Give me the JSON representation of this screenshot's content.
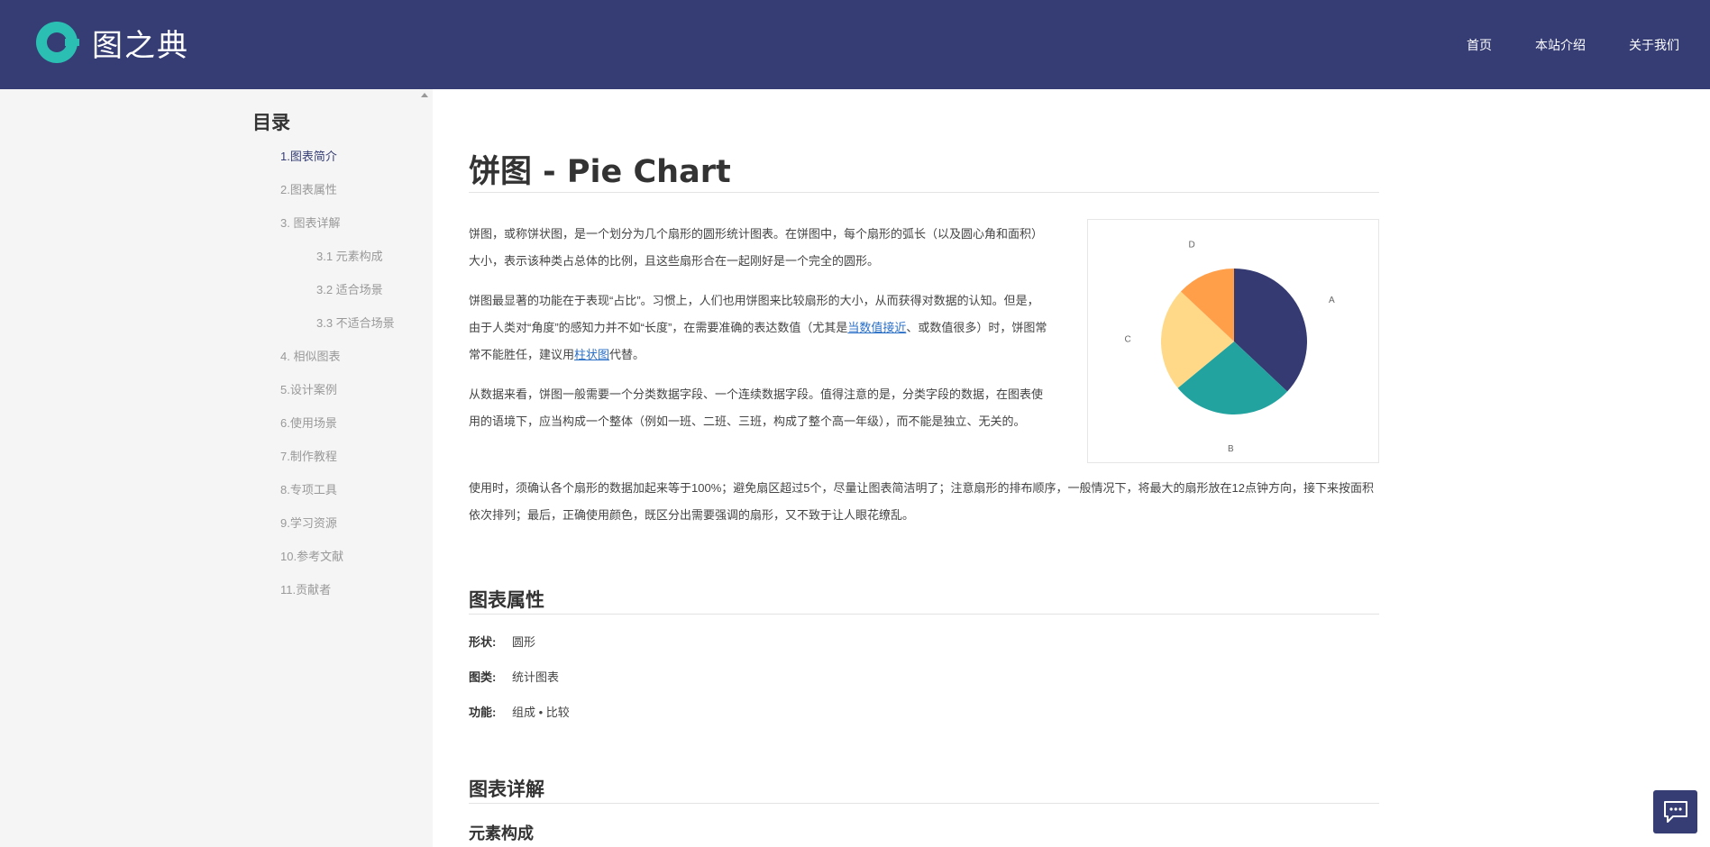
{
  "header": {
    "logo_text": "图之典",
    "nav": [
      "首页",
      "本站介绍",
      "关于我们"
    ]
  },
  "toc": {
    "title": "目录",
    "items": [
      {
        "label": "1.图表简介",
        "active": true
      },
      {
        "label": "2.图表属性"
      },
      {
        "label": "3. 图表详解"
      },
      {
        "label": "3.1 元素构成"
      },
      {
        "label": "3.2 适合场景"
      },
      {
        "label": "3.3 不适合场景"
      },
      {
        "label": "4. 相似图表"
      },
      {
        "label": "5.设计案例"
      },
      {
        "label": "6.使用场景"
      },
      {
        "label": "7.制作教程"
      },
      {
        "label": "8.专项工具"
      },
      {
        "label": "9.学习资源"
      },
      {
        "label": "10.参考文献"
      },
      {
        "label": "11.贡献者"
      }
    ]
  },
  "article": {
    "title": "饼图 - Pie Chart",
    "p1": "饼图，或称饼状图，是一个划分为几个扇形的圆形统计图表。在饼图中，每个扇形的弧长（以及圆心角和面积）大小，表示该种类占总体的比例，且这些扇形合在一起刚好是一个完全的圆形。",
    "p2_a": "饼图最显著的功能在于表现“占比”。习惯上，人们也用饼图来比较扇形的大小，从而获得对数据的认知。但是，由于人类对“角度”的感知力并不如“长度”，在需要准确的表达数值（尤其是",
    "p2_link1": "当数值接近",
    "p2_b": "、或数值很多）时，饼图常常不能胜任，建议用",
    "p2_link2": "柱状图",
    "p2_c": "代替。",
    "p3": "从数据来看，饼图一般需要一个分类数据字段、一个连续数据字段。值得注意的是，分类字段的数据，在图表使用的语境下，应当构成一个整体（例如一班、二班、三班，构成了整个高一年级），而不能是独立、无关的。",
    "p4": "使用时，须确认各个扇形的数据加起来等于100%；避免扇区超过5个，尽量让图表简洁明了；注意扇形的排布顺序，一般情况下，将最大的扇形放在12点钟方向，接下来按面积依次排列；最后，正确使用颜色，既区分出需要强调的扇形，又不致于让人眼花缭乱。"
  },
  "chart_data": {
    "type": "pie",
    "categories": [
      "A",
      "B",
      "C",
      "D"
    ],
    "values": [
      37,
      27,
      23,
      13
    ],
    "colors": [
      "#353b72",
      "#22a39f",
      "#ffd987",
      "#ff9f4a"
    ],
    "start": "12-o'clock",
    "direction": "clockwise"
  },
  "properties": {
    "title": "图表属性",
    "rows": [
      {
        "key": "形状:",
        "value": "圆形"
      },
      {
        "key": "图类:",
        "value": "统计图表"
      },
      {
        "key": "功能:",
        "value": "组成 • 比较"
      }
    ]
  },
  "details": {
    "title": "图表详解",
    "sub": "元素构成"
  },
  "icons": {
    "logo": "logo-icon",
    "chat": "chat-icon"
  }
}
